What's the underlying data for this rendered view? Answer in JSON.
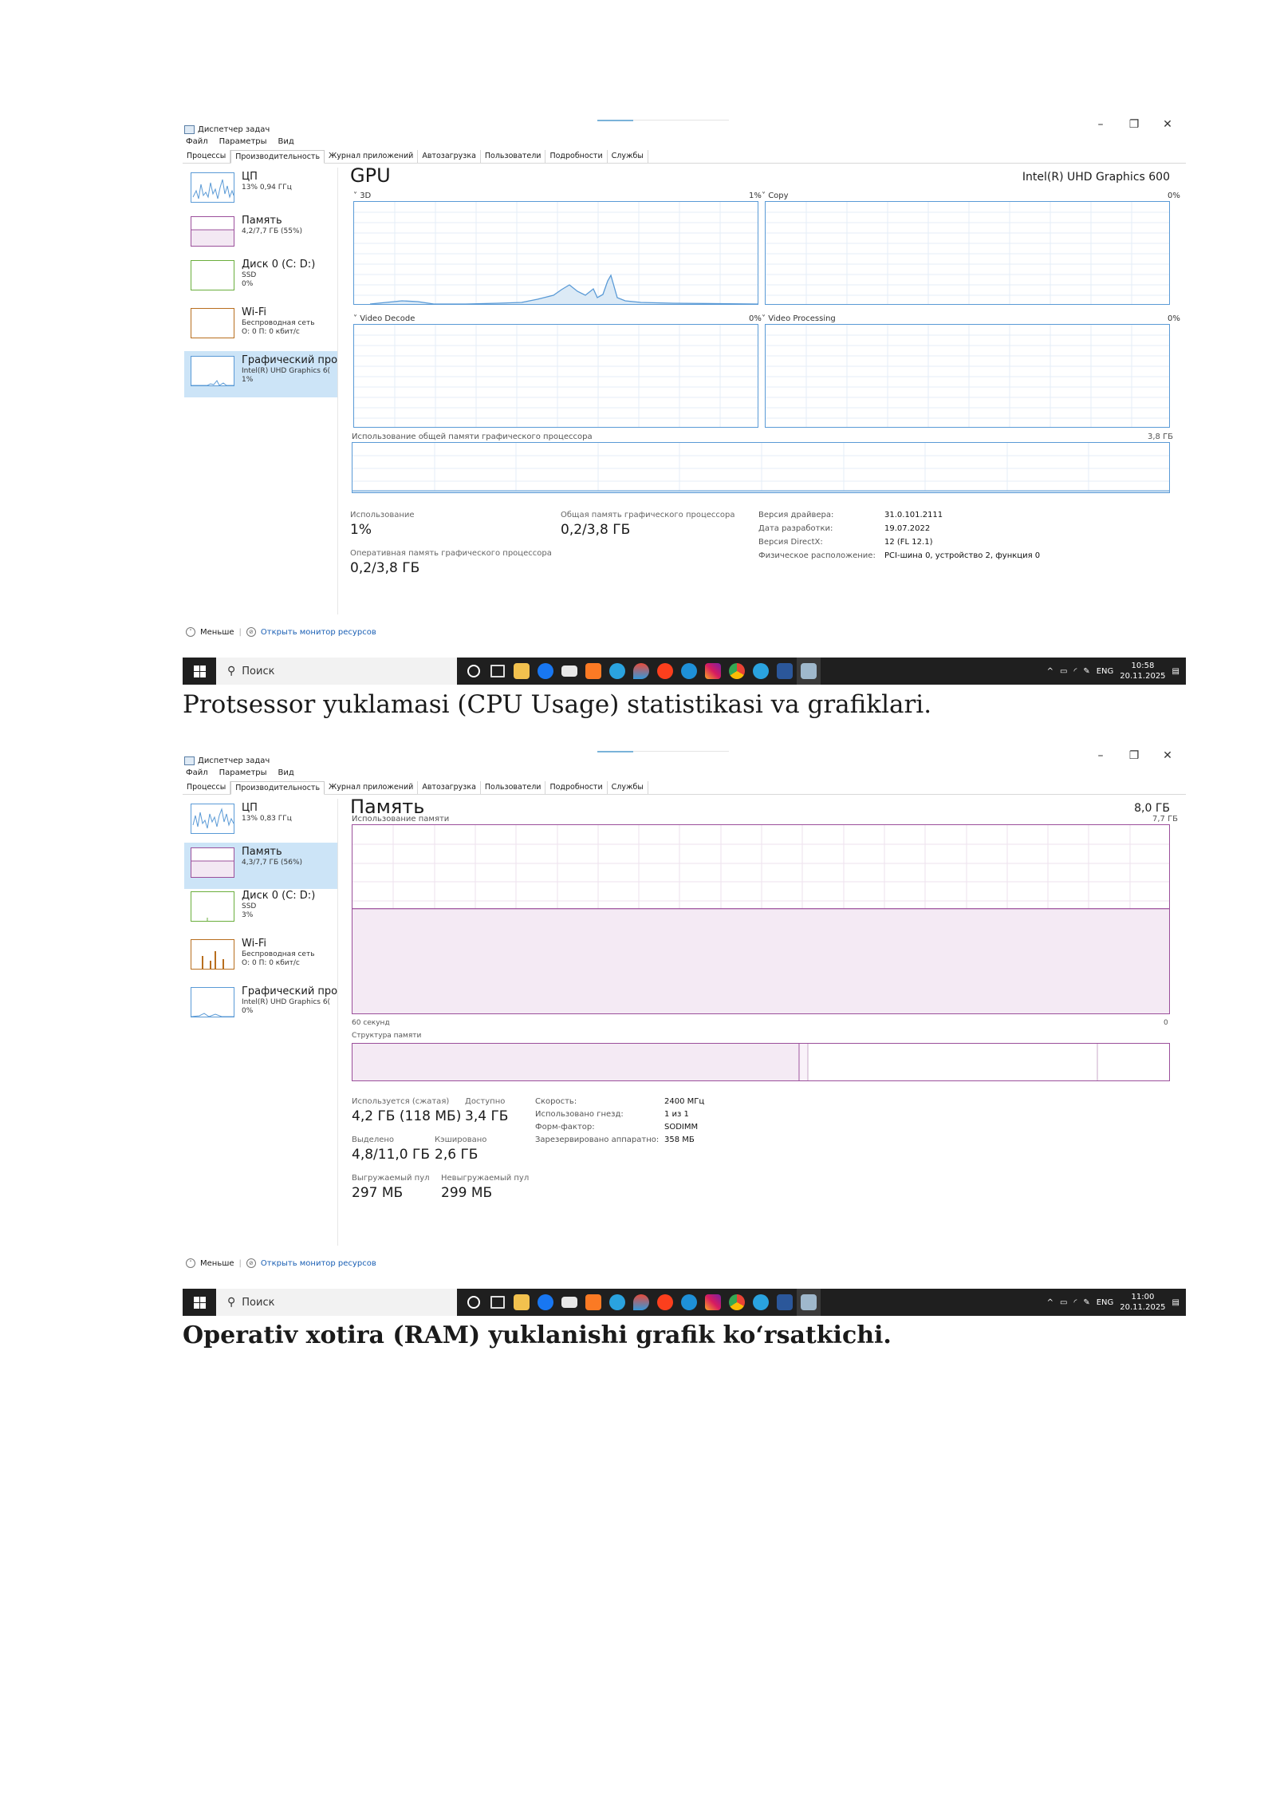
{
  "window_title": "Диспетчер задач",
  "menu": [
    "Файл",
    "Параметры",
    "Вид"
  ],
  "tabs": [
    "Процессы",
    "Производительность",
    "Журнал приложений",
    "Автозагрузка",
    "Пользователи",
    "Подробности",
    "Службы"
  ],
  "window_controls": {
    "minimize": "–",
    "restore": "❐",
    "close": "✕"
  },
  "footer": {
    "less": "Меньше",
    "open_monitor": "Открыть монитор ресурсов"
  },
  "shot1": {
    "sidebar": [
      {
        "name": "ЦП",
        "sub1": "13% 0,94 ГГц",
        "sub2": "",
        "sub3": ""
      },
      {
        "name": "Память",
        "sub1": "4,2/7,7 ГБ (55%)",
        "sub2": "",
        "sub3": ""
      },
      {
        "name": "Диск 0 (C: D:)",
        "sub1": "SSD",
        "sub2": "0%",
        "sub3": ""
      },
      {
        "name": "Wi-Fi",
        "sub1": "Беспроводная сеть",
        "sub2": "О: 0 П: 0 кбит/с",
        "sub3": ""
      },
      {
        "name": "Графический про",
        "sub1": "Intel(R) UHD Graphics 6(",
        "sub2": "1%",
        "sub3": ""
      }
    ],
    "title": "GPU",
    "device": "Intel(R) UHD Graphics 600",
    "engines": [
      {
        "name": "3D",
        "pct": "1%"
      },
      {
        "name": "Copy",
        "pct": "0%"
      },
      {
        "name": "Video Decode",
        "pct": "0%"
      },
      {
        "name": "Video Processing",
        "pct": "0%"
      }
    ],
    "shared_mem_label": "Использование общей памяти графического процессора",
    "shared_mem_max": "3,8 ГБ",
    "stats": {
      "usage_label": "Использование",
      "usage": "1%",
      "shared_label": "Общая память графического процессора",
      "shared": "0,2/3,8 ГБ",
      "dedicated_label": "Оперативная память графического процессора",
      "dedicated": "0,2/3,8 ГБ"
    },
    "info": [
      {
        "key": "Версия драйвера:",
        "val": "31.0.101.2111"
      },
      {
        "key": "Дата разработки:",
        "val": "19.07.2022"
      },
      {
        "key": "Версия DirectX:",
        "val": "12 (FL 12.1)"
      },
      {
        "key": "Физическое расположение:",
        "val": "PCI-шина 0, устройство 2, функция 0"
      }
    ],
    "time": "10:58",
    "date": "20.11.2025"
  },
  "shot2": {
    "sidebar": [
      {
        "name": "ЦП",
        "sub1": "13% 0,83 ГГц",
        "sub2": "",
        "sub3": ""
      },
      {
        "name": "Память",
        "sub1": "4,3/7,7 ГБ (56%)",
        "sub2": "",
        "sub3": ""
      },
      {
        "name": "Диск 0 (C: D:)",
        "sub1": "SSD",
        "sub2": "3%",
        "sub3": ""
      },
      {
        "name": "Wi-Fi",
        "sub1": "Беспроводная сеть",
        "sub2": "О: 0 П: 0 кбит/с",
        "sub3": ""
      },
      {
        "name": "Графический про",
        "sub1": "Intel(R) UHD Graphics 6(",
        "sub2": "0%",
        "sub3": ""
      }
    ],
    "title": "Память",
    "total": "8,0 ГБ",
    "usage_label": "Использование памяти",
    "usage_max": "7,7 ГБ",
    "axis_left": "60 секунд",
    "axis_right": "0",
    "structure_label": "Структура памяти",
    "memory_usage_fraction": 0.56,
    "stats": [
      {
        "label": "Используется (сжатая)",
        "value": "4,2 ГБ (118 МБ)"
      },
      {
        "label": "Доступно",
        "value": "3,4 ГБ"
      },
      {
        "label": "Выделено",
        "value": "4,8/11,0 ГБ"
      },
      {
        "label": "Кэшировано",
        "value": "2,6 ГБ"
      },
      {
        "label": "Выгружаемый пул",
        "value": "297 МБ"
      },
      {
        "label": "Невыгружаемый пул",
        "value": "299 МБ"
      }
    ],
    "info": [
      {
        "key": "Скорость:",
        "val": "2400 МГц"
      },
      {
        "key": "Использовано гнезд:",
        "val": "1 из 1"
      },
      {
        "key": "Форм-фактор:",
        "val": "SODIMM"
      },
      {
        "key": "Зарезервировано аппаратно:",
        "val": "358 МБ"
      }
    ],
    "time": "11:00",
    "date": "20.11.2025"
  },
  "taskbar": {
    "search_placeholder": "Поиск",
    "lang": "ENG"
  },
  "captions": {
    "cap1": "Protsessor yuklamasi (CPU Usage) statistikasi va grafiklari.",
    "cap2": "Operativ xotira (RAM) yuklanishi grafik ko‘rsatkichi."
  },
  "colors": {
    "cpu_blue": "#5a9ad6",
    "memory_purple": "#9b4f9b",
    "disk_green": "#6aae3c",
    "wifi_orange": "#b86e1e",
    "taskbar": "#1f1f1f"
  }
}
